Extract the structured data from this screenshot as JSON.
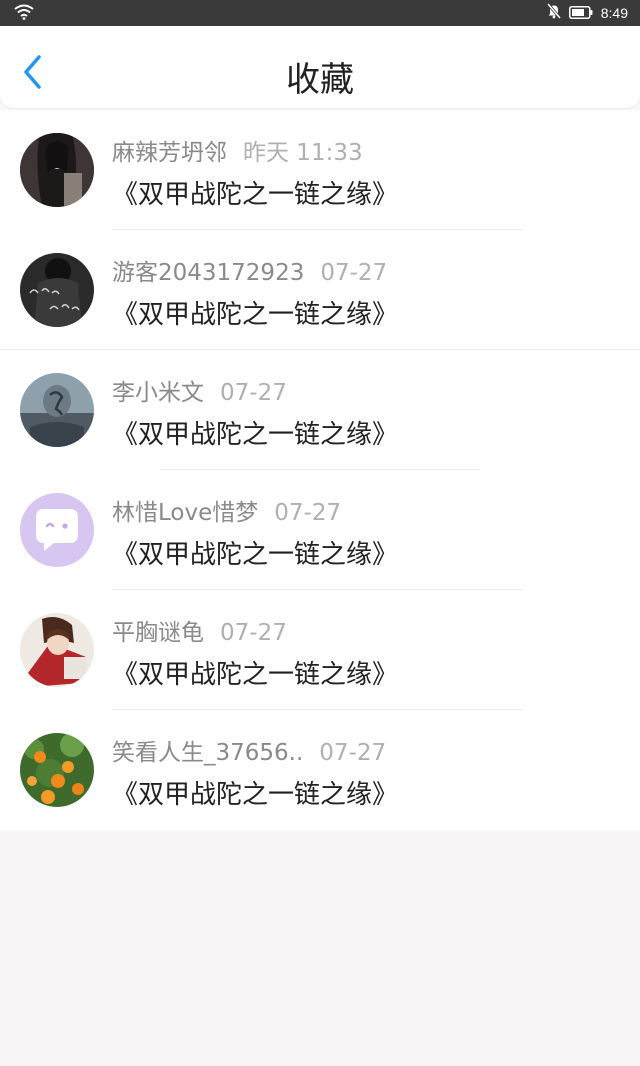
{
  "status_bar": {
    "time": "8:49"
  },
  "header": {
    "title": "收藏"
  },
  "favorites": [
    {
      "user": "麻辣芳坍邻",
      "date": "昨天 11:33",
      "work": "《双甲战陀之一链之缘》",
      "avatar": "dark-hair-avatar"
    },
    {
      "user": "游客2043172923",
      "date": "07-27",
      "work": "《双甲战陀之一链之缘》",
      "avatar": "calligraphy-avatar"
    },
    {
      "user": "李小米文",
      "date": "07-27",
      "work": "《双甲战陀之一链之缘》",
      "avatar": "statue-avatar"
    },
    {
      "user": "林惜Love惜梦",
      "date": "07-27",
      "work": "《双甲战陀之一链之缘》",
      "avatar": "chat-bubble-avatar"
    },
    {
      "user": "平胸谜龟",
      "date": "07-27",
      "work": "《双甲战陀之一链之缘》",
      "avatar": "anime-character-avatar"
    },
    {
      "user": "笑看人生_37656..",
      "date": "07-27",
      "work": "《双甲战陀之一链之缘》",
      "avatar": "orange-tree-avatar"
    }
  ]
}
